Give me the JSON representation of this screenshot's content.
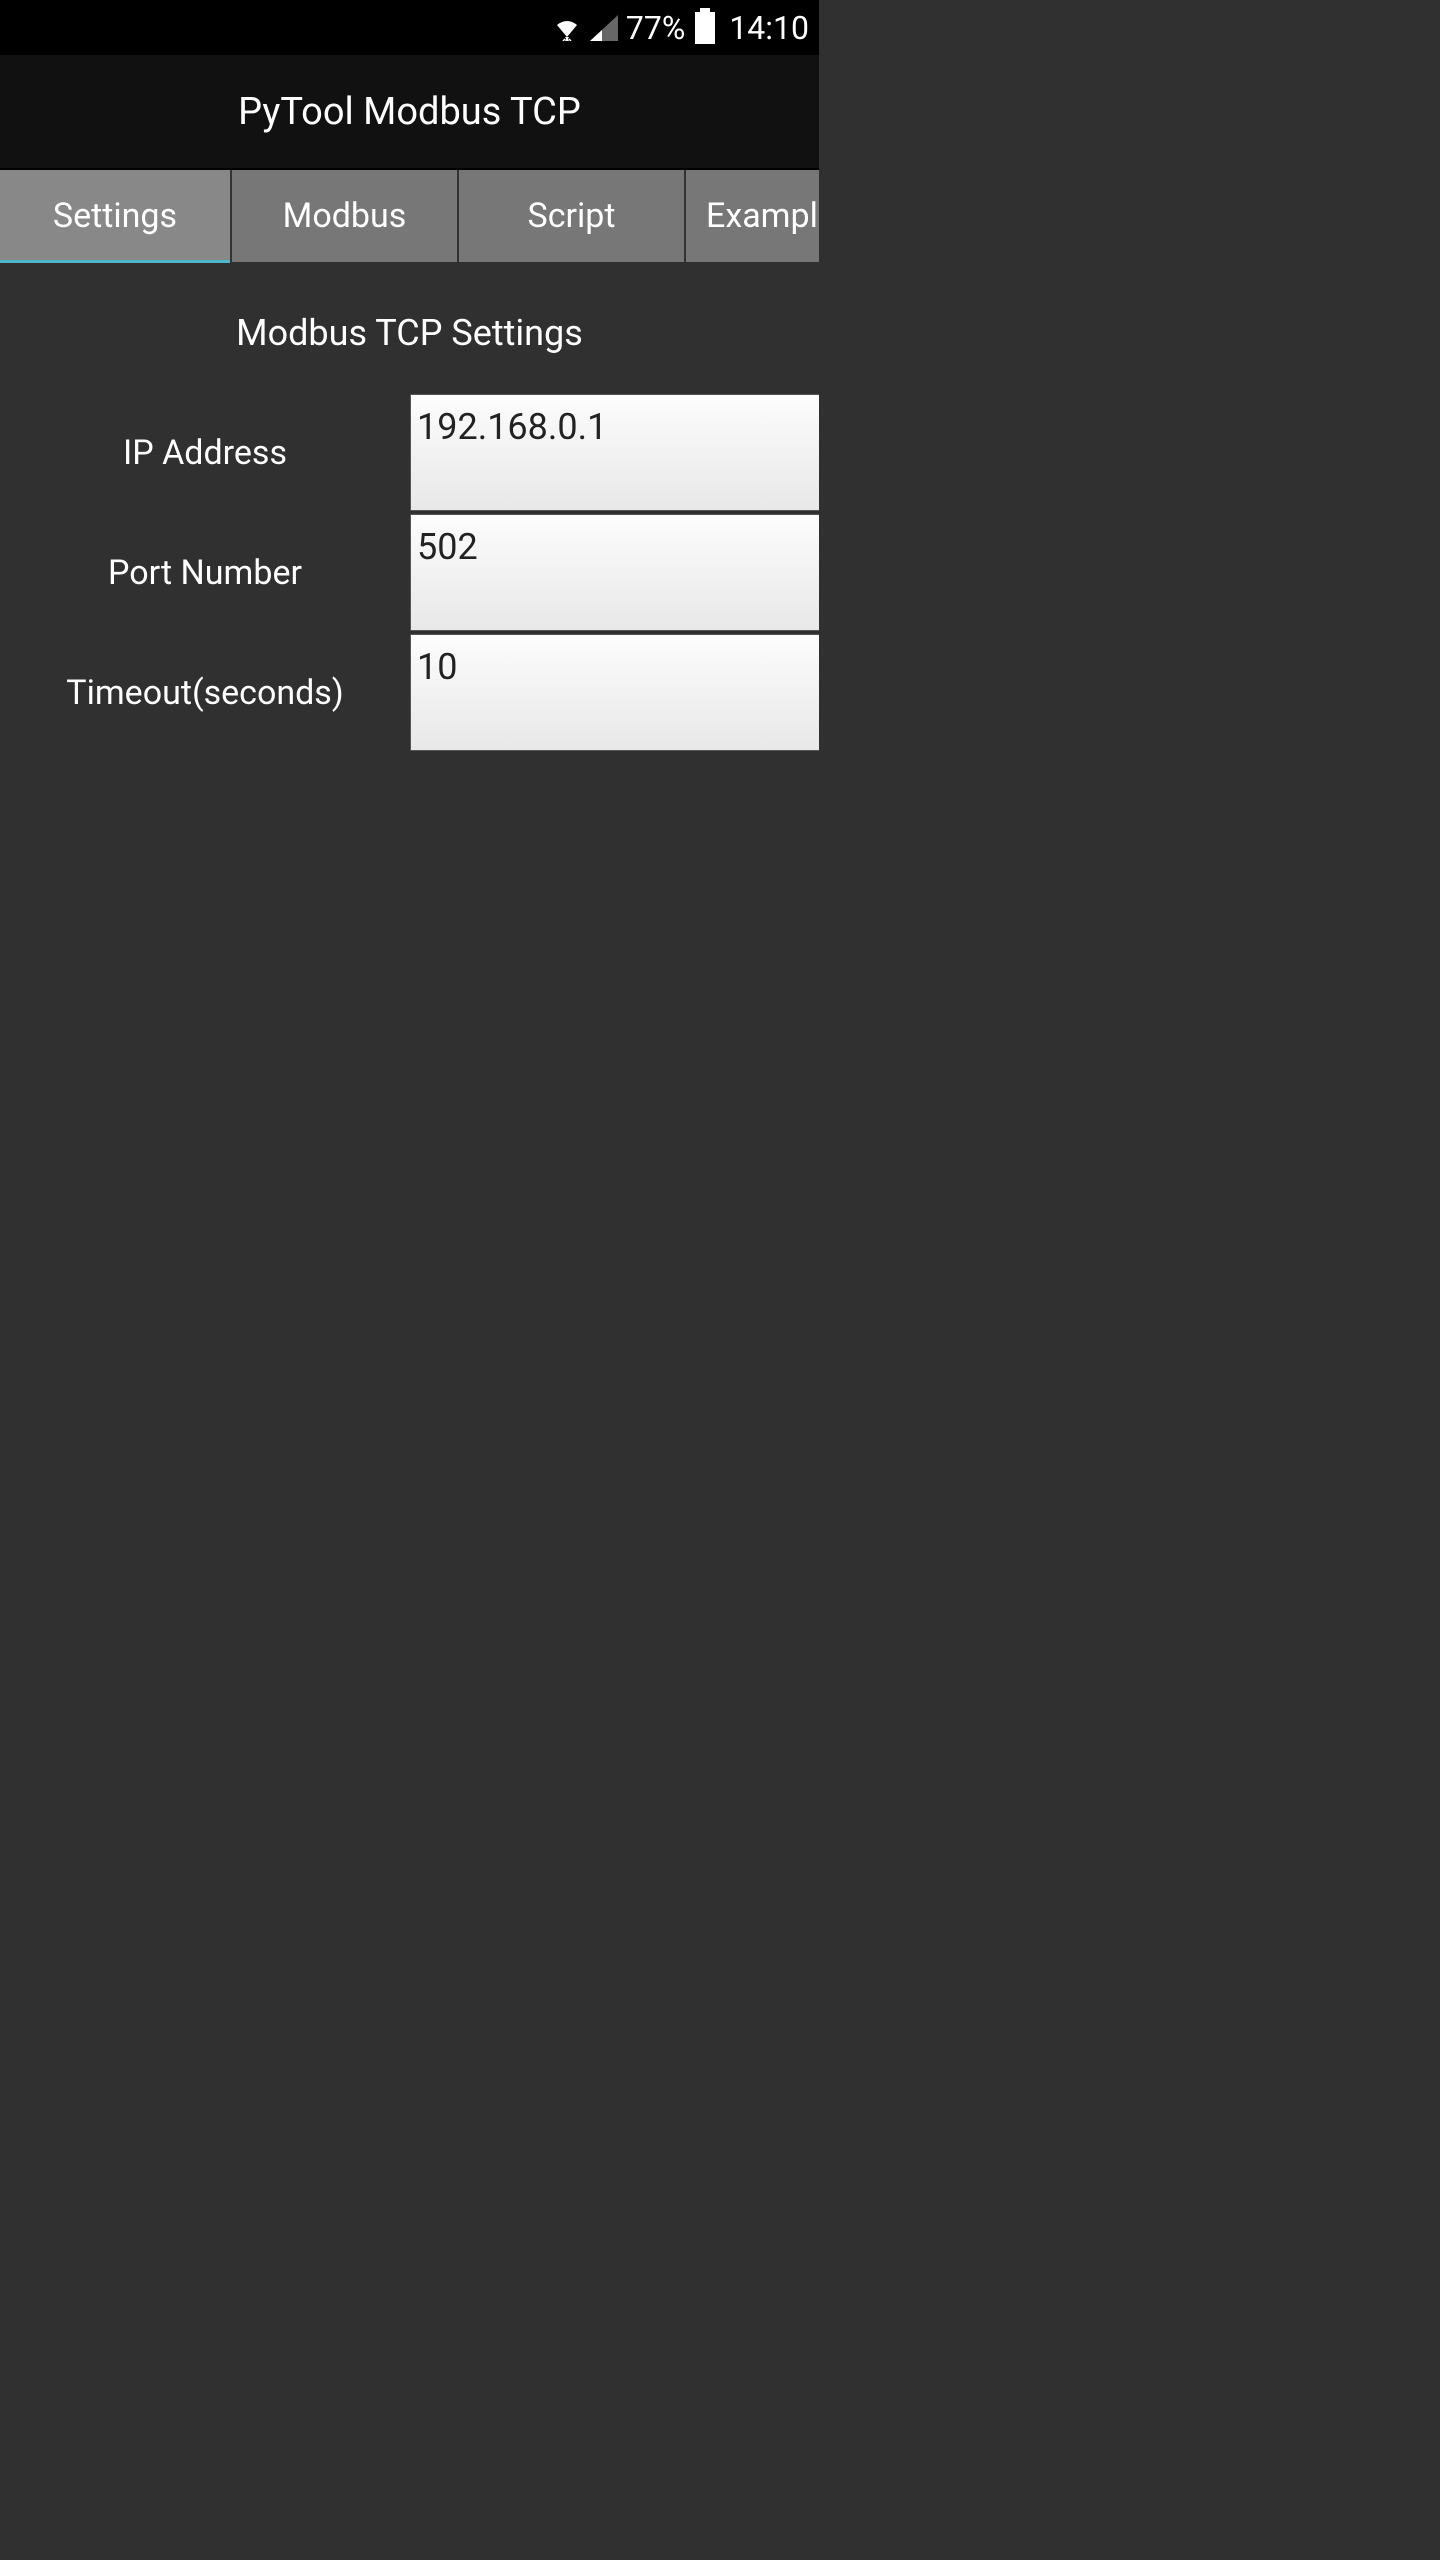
{
  "status_bar": {
    "battery_pct": "77%",
    "time": "14:10"
  },
  "header": {
    "title": "PyTool Modbus TCP"
  },
  "tabs": {
    "settings": "Settings",
    "modbus": "Modbus",
    "script": "Script",
    "example": "Example"
  },
  "section": {
    "title": "Modbus TCP Settings"
  },
  "form": {
    "ip_label": "IP Address",
    "ip_value": "192.168.0.1",
    "port_label": "Port Number",
    "port_value": "502",
    "timeout_label": "Timeout(seconds)",
    "timeout_value": "10"
  }
}
